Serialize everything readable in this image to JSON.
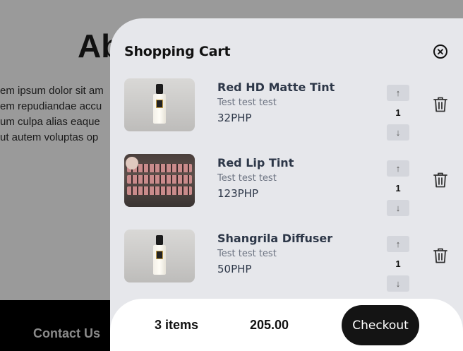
{
  "background": {
    "heading": "Ab",
    "paragraph_lines": [
      "em ipsum dolor sit am",
      "em repudiandae accu",
      "um culpa alias eaque",
      "ut autem voluptas op"
    ],
    "footer_text": "Contact Us"
  },
  "cart": {
    "title": "Shopping Cart",
    "close_icon": "close-circle-icon",
    "items": [
      {
        "name": "Red HD Matte Tint",
        "description": "Test test test",
        "price": "32PHP",
        "quantity": "1",
        "image": "perfume-bottle"
      },
      {
        "name": "Red Lip Tint",
        "description": "Test test test",
        "price": "123PHP",
        "quantity": "1",
        "image": "lip-tint-rows"
      },
      {
        "name": "Shangrila Diffuser",
        "description": "Test test test",
        "price": "50PHP",
        "quantity": "1",
        "image": "perfume-bottle"
      }
    ],
    "stepper_up_icon": "arrow-up-icon",
    "stepper_down_icon": "arrow-down-icon",
    "delete_icon": "trash-icon"
  },
  "footer": {
    "item_count": "3 items",
    "total": "205.00",
    "checkout_label": "Checkout"
  }
}
